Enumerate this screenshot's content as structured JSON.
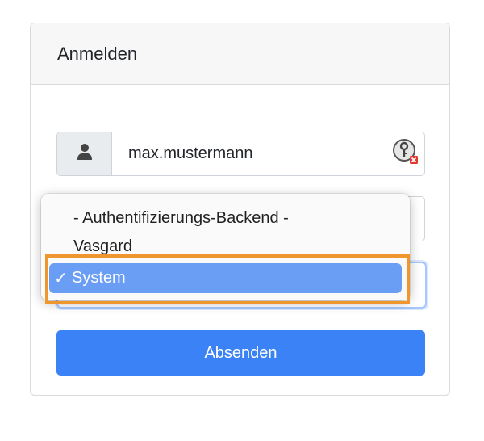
{
  "card": {
    "title": "Anmelden"
  },
  "username": {
    "value": "max.mustermann",
    "addon_icon": "user-icon",
    "password_manager_icon": "key-icon"
  },
  "backend_dropdown": {
    "options": [
      {
        "label": "- Authentifizierungs-Backend -",
        "selected": false
      },
      {
        "label": "Vasgard",
        "selected": false
      },
      {
        "label": "System",
        "selected": true
      }
    ],
    "check_mark": "✓"
  },
  "submit": {
    "label": "Absenden"
  },
  "colors": {
    "primary": "#3b82f6",
    "selected_option": "#6a9ef5",
    "highlight": "#f0962e"
  }
}
